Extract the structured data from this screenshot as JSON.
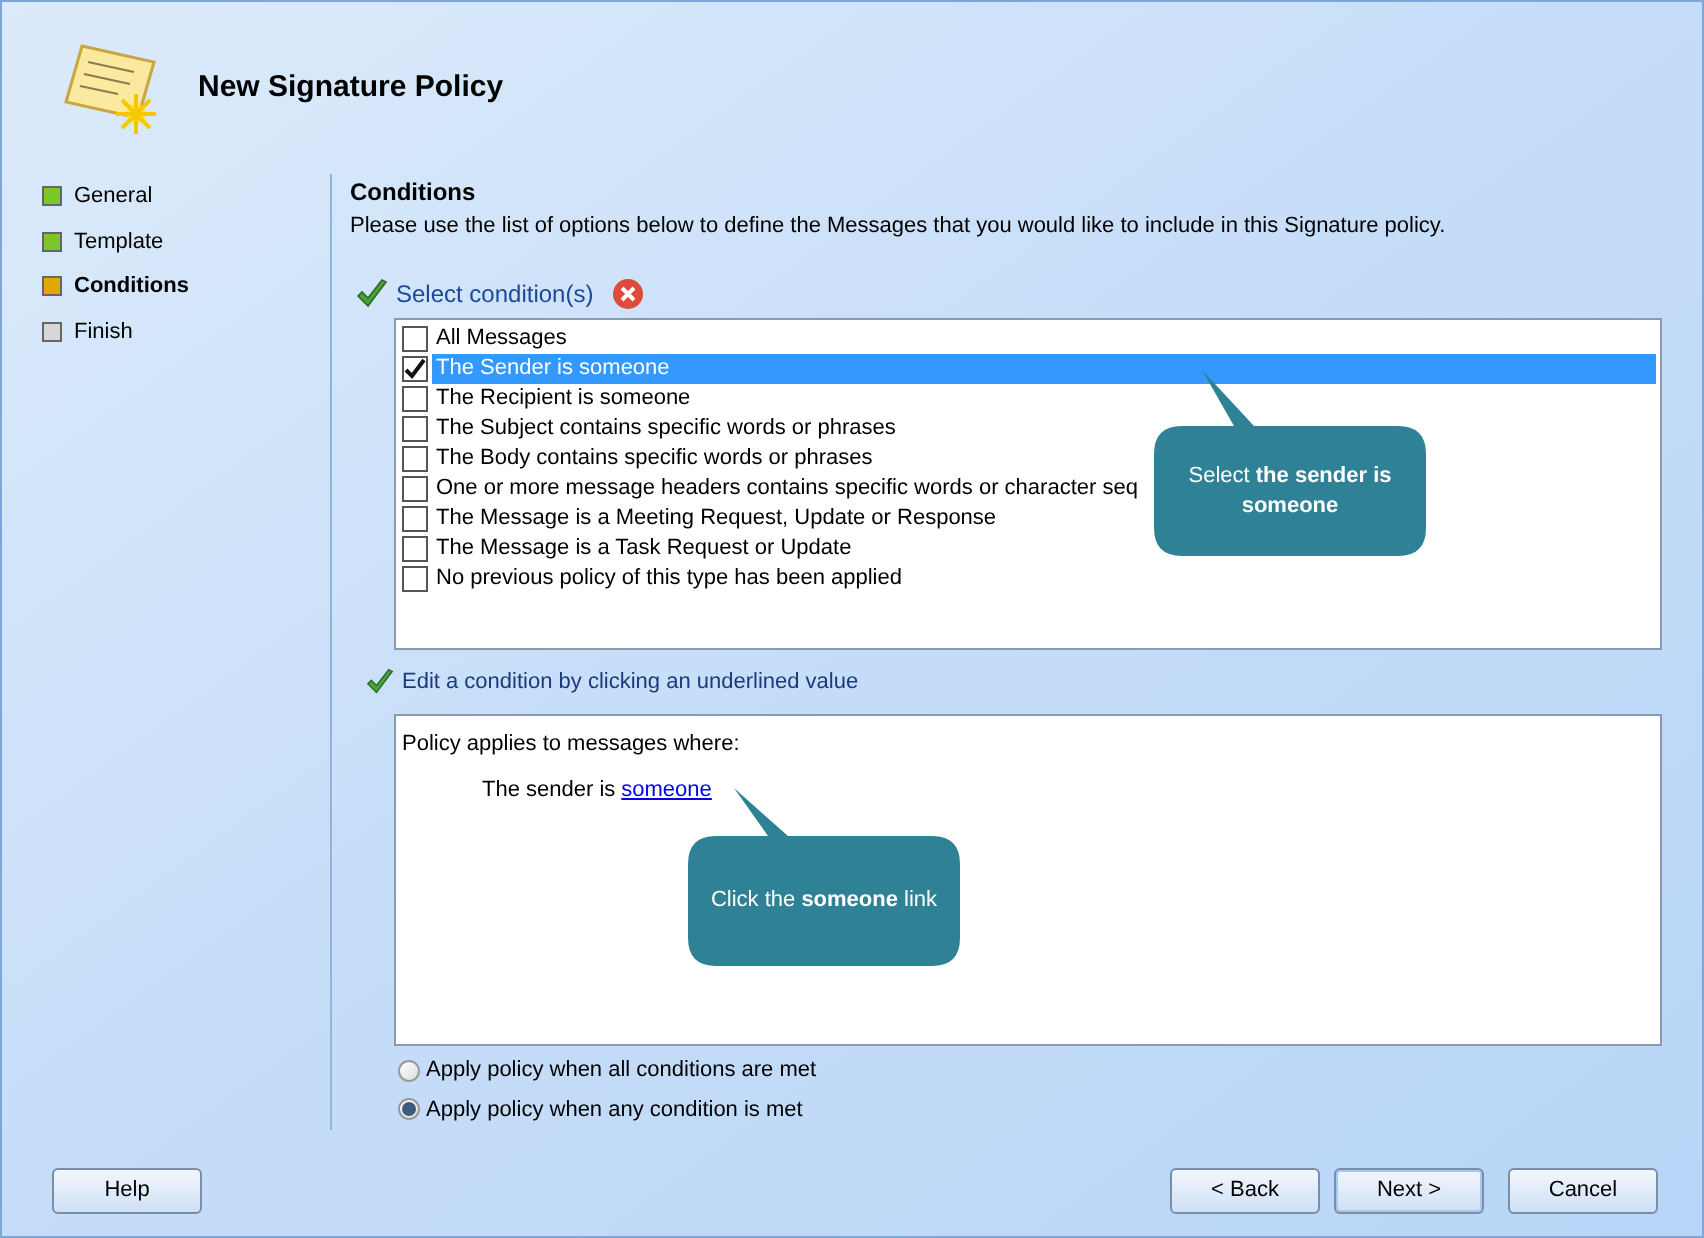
{
  "window": {
    "title": "New Signature Policy"
  },
  "steps": [
    {
      "label": "General",
      "color": "#7cc62a",
      "selected": false
    },
    {
      "label": "Template",
      "color": "#7cc62a",
      "selected": false
    },
    {
      "label": "Conditions",
      "color": "#e0a800",
      "selected": true
    },
    {
      "label": "Finish",
      "color": "#d8d8d8",
      "selected": false
    }
  ],
  "section": {
    "heading": "Conditions",
    "description": "Please use the list of options below to define the Messages that you would like to include in this Signature policy."
  },
  "select_label": "Select condition(s)",
  "conditions": [
    {
      "label": "All Messages",
      "checked": false,
      "selected": false
    },
    {
      "label": "The Sender is someone",
      "checked": true,
      "selected": true
    },
    {
      "label": "The Recipient is someone",
      "checked": false,
      "selected": false
    },
    {
      "label": "The Subject contains specific words or phrases",
      "checked": false,
      "selected": false
    },
    {
      "label": "The Body contains specific words or phrases",
      "checked": false,
      "selected": false
    },
    {
      "label": "One or more message headers contains specific words or character seq",
      "checked": false,
      "selected": false
    },
    {
      "label": "The Message is a Meeting Request, Update or Response",
      "checked": false,
      "selected": false
    },
    {
      "label": "The Message is a Task Request or Update",
      "checked": false,
      "selected": false
    },
    {
      "label": "No previous policy of this type has been applied",
      "checked": false,
      "selected": false
    }
  ],
  "edit_label": "Edit a condition by clicking an underlined value",
  "policy": {
    "intro": "Policy applies to messages where:",
    "rule_text": "The sender is",
    "rule_link": "someone"
  },
  "callouts": [
    {
      "text": "Select **the sender is someone**"
    },
    {
      "text": "Click the **someone** link"
    }
  ],
  "match_options": [
    {
      "label": "Apply policy when all conditions are met",
      "selected": false
    },
    {
      "label": "Apply policy when any condition is met",
      "selected": true
    }
  ],
  "buttons": [
    {
      "label": "Help",
      "kind": "help"
    },
    {
      "label": "< Back",
      "kind": "nav"
    },
    {
      "label": "Next >",
      "kind": "default"
    },
    {
      "label": "Cancel",
      "kind": "nav"
    }
  ]
}
